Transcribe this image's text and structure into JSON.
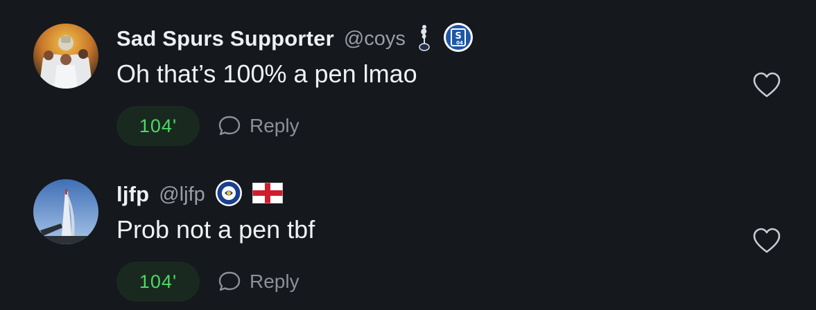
{
  "comments": [
    {
      "username": "Sad Spurs Supporter",
      "handle": "@coys",
      "badges": [
        "cockerel-crest-icon",
        "schalke-crest-icon"
      ],
      "badge_text": "S 04",
      "text": "Oh that’s 100% a pen lmao",
      "minute": "104'",
      "reply_label": "Reply",
      "liked": false
    },
    {
      "username": "ljfp",
      "handle": "@ljfp",
      "badges": [
        "portsmouth-crest-icon",
        "england-flag-icon"
      ],
      "text": "Prob not a pen tbf",
      "minute": "104'",
      "reply_label": "Reply",
      "liked": false
    }
  ],
  "colors": {
    "background": "#15181d",
    "minute_chip_bg": "#19291f",
    "minute_chip_text": "#4cd964",
    "muted_text": "#9a9ea6",
    "schalke_blue": "#1f57a6",
    "portsmouth_blue": "#1b3f8f",
    "england_red": "#d01d2b"
  }
}
